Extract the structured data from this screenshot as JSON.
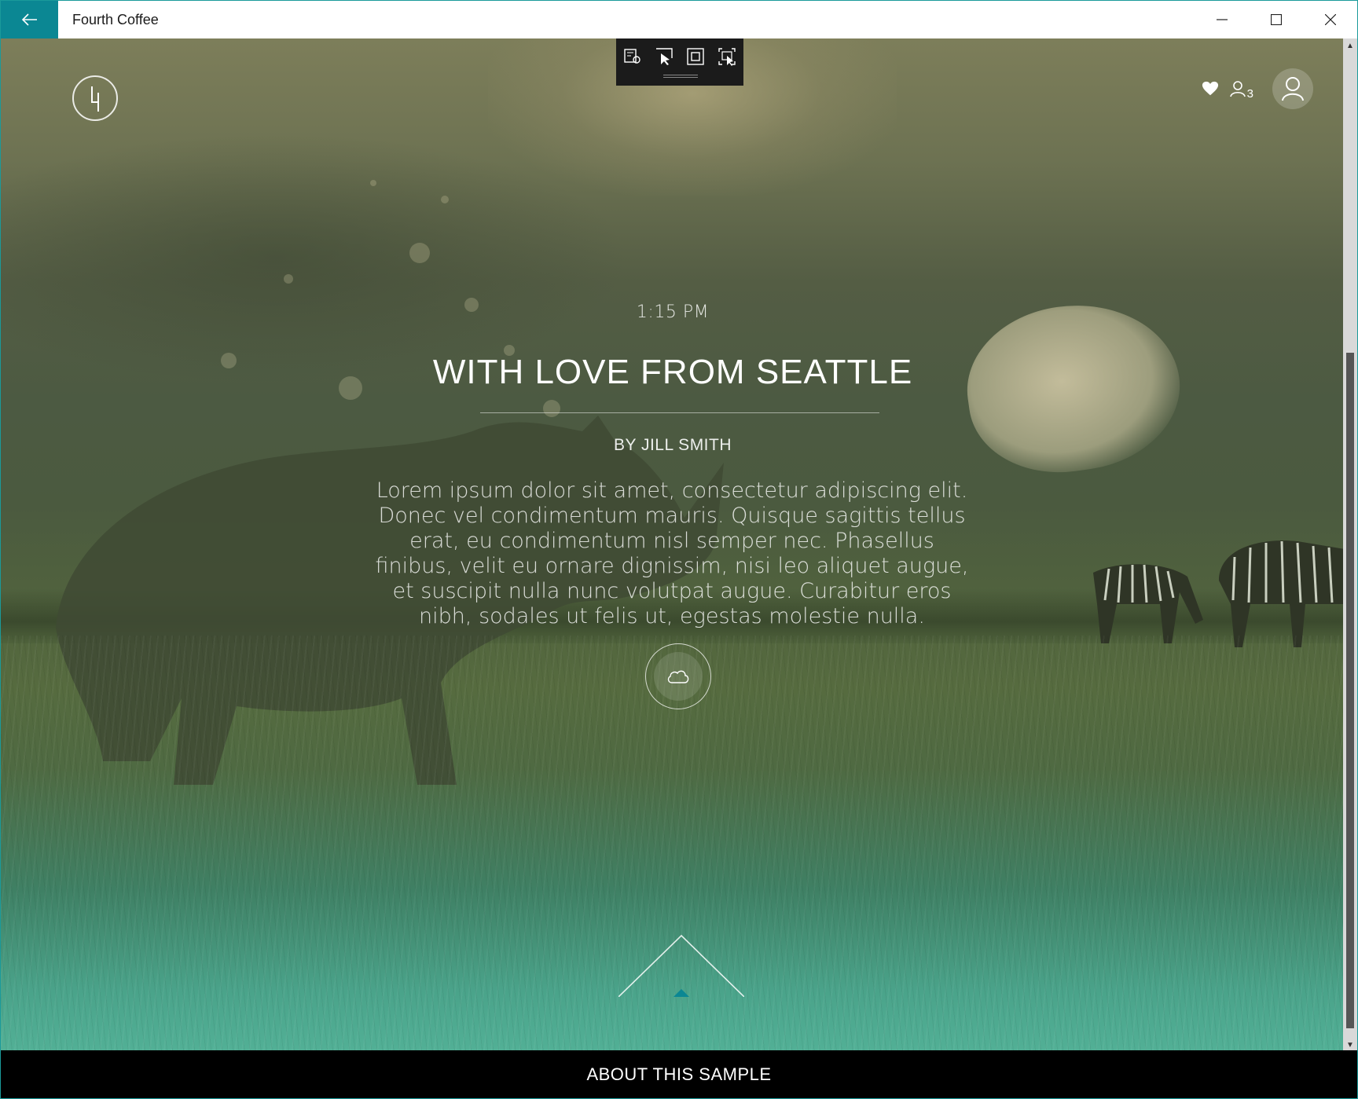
{
  "window": {
    "title": "Fourth Coffee",
    "accent_color": "#0b8793"
  },
  "toolbar": {
    "icons": [
      "live-visual-tree-icon",
      "select-element-icon",
      "display-layout-adorners-icon",
      "track-focused-element-icon"
    ]
  },
  "header": {
    "logo_glyph": "4",
    "people_count": "3"
  },
  "article": {
    "time": "1:15 PM",
    "headline": "WITH LOVE FROM SEATTLE",
    "byline": "BY JILL SMITH",
    "body": "Lorem ipsum dolor sit amet, consectetur adipiscing elit. Donec vel condimentum mauris. Quisque sagittis tellus erat, eu condimentum nisl semper nec. Phasellus finibus, velit eu ornare dignissim, nisi leo aliquet augue, et suscipit nulla nunc volutpat augue. Curabitur eros nibh, sodales ut felis ut, egestas molestie nulla."
  },
  "footer": {
    "label": "ABOUT THIS SAMPLE"
  },
  "colors": {
    "sky_top": "#7d7e5a",
    "grass_bottom": "#52b096",
    "footer_bg": "#000000"
  }
}
